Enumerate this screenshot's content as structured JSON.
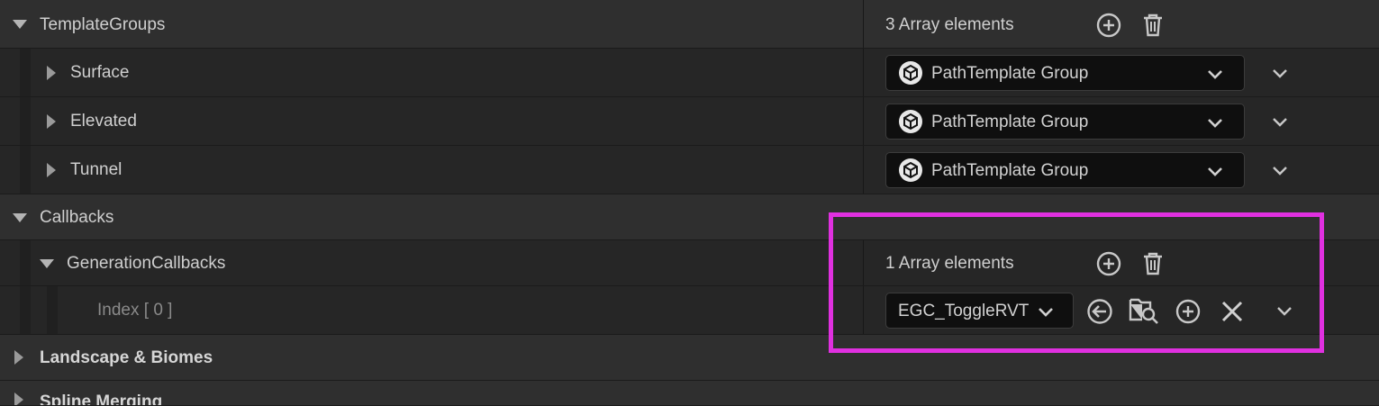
{
  "template_groups": {
    "label": "TemplateGroups",
    "count_text": "3 Array elements",
    "items": [
      {
        "label": "Surface",
        "value": "PathTemplate Group"
      },
      {
        "label": "Elevated",
        "value": "PathTemplate Group"
      },
      {
        "label": "Tunnel",
        "value": "PathTemplate Group"
      }
    ]
  },
  "callbacks": {
    "label": "Callbacks",
    "generation": {
      "label": "GenerationCallbacks",
      "count_text": "1 Array elements",
      "index_label": "Index [ 0 ]",
      "value": "EGC_ToggleRVT"
    }
  },
  "sections": {
    "landscape": "Landscape & Biomes",
    "spline_merging": "Spline Merging"
  },
  "colors": {
    "highlight": "#e030e0",
    "panel_bg": "#262626",
    "category_bg": "#2f2f2f"
  },
  "icons": [
    "add-icon",
    "trash-icon",
    "cube-icon",
    "chevron-down-icon",
    "use-selected-icon",
    "browse-asset-icon",
    "clear-icon"
  ]
}
